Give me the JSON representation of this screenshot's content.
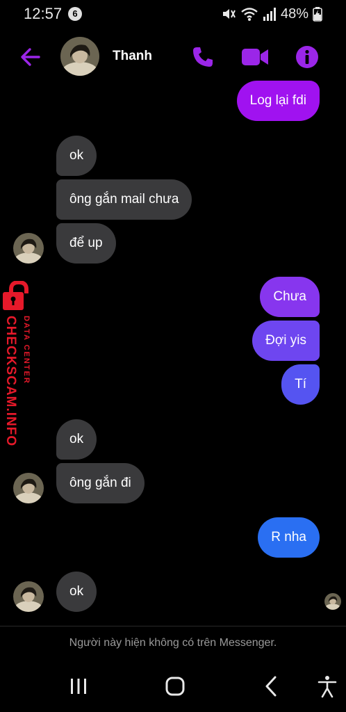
{
  "status_bar": {
    "time": "12:57",
    "notification_count": "6",
    "battery": "48%"
  },
  "header": {
    "contact_name": "Thanh",
    "back_icon": "arrow-left-icon",
    "call_icon": "phone-icon",
    "video_icon": "video-camera-icon",
    "info_icon": "info-icon"
  },
  "messages": [
    {
      "side": "out",
      "text": "Log lại fdi"
    },
    {
      "side": "in",
      "text": "ok"
    },
    {
      "side": "in",
      "text": "ông gắn mail chưa"
    },
    {
      "side": "in",
      "text": "để up"
    },
    {
      "side": "out",
      "text": "Chưa"
    },
    {
      "side": "out",
      "text": "Đợi yis"
    },
    {
      "side": "out",
      "text": "Tí"
    },
    {
      "side": "in",
      "text": "ok"
    },
    {
      "side": "in",
      "text": "ông gắn đi"
    },
    {
      "side": "out",
      "text": "R nha"
    },
    {
      "side": "in",
      "text": "ok"
    }
  ],
  "watermark": {
    "line1": "DATA CENTER",
    "line2": "CHECKSCAM.INFO"
  },
  "footer": {
    "notice": "Người này hiện không có trên Messenger."
  },
  "nav_bar": {
    "recents_icon": "recents-icon",
    "home_icon": "home-icon",
    "back_icon": "back-chevron-icon",
    "accessibility_icon": "accessibility-icon"
  },
  "colors": {
    "accent_purple": "#9b26e8",
    "bubble_in": "#3a3a3c",
    "gradient_top": "#a012f0",
    "gradient_mid": "#7a44f2",
    "gradient_bottom": "#1f76f2",
    "watermark_red": "#e6192a"
  }
}
